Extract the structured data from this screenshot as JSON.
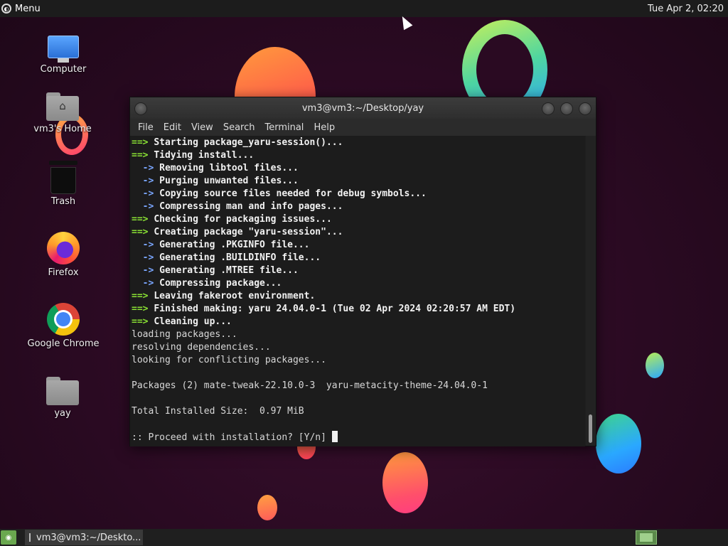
{
  "top_panel": {
    "menu_label": "Menu",
    "clock": "Tue Apr  2, 02:20"
  },
  "desktop": {
    "icons": [
      {
        "label": "Computer",
        "icon": "computer-icon"
      },
      {
        "label": "vm3's Home",
        "icon": "home-folder-icon"
      },
      {
        "label": "Trash",
        "icon": "trash-icon"
      },
      {
        "label": "Firefox",
        "icon": "firefox-icon"
      },
      {
        "label": "Google Chrome",
        "icon": "chrome-icon"
      },
      {
        "label": "yay",
        "icon": "folder-icon"
      }
    ]
  },
  "window": {
    "title": "vm3@vm3:~/Desktop/yay",
    "menu": [
      "File",
      "Edit",
      "View",
      "Search",
      "Terminal",
      "Help"
    ],
    "lines": [
      {
        "prefix": "==> ",
        "kind": "g",
        "text": "Starting package_yaru-session()..."
      },
      {
        "prefix": "==> ",
        "kind": "g",
        "text": "Tidying install..."
      },
      {
        "prefix": "  -> ",
        "kind": "bl",
        "text": "Removing libtool files..."
      },
      {
        "prefix": "  -> ",
        "kind": "bl",
        "text": "Purging unwanted files..."
      },
      {
        "prefix": "  -> ",
        "kind": "bl",
        "text": "Copying source files needed for debug symbols..."
      },
      {
        "prefix": "  -> ",
        "kind": "bl",
        "text": "Compressing man and info pages..."
      },
      {
        "prefix": "==> ",
        "kind": "g",
        "text": "Checking for packaging issues..."
      },
      {
        "prefix": "==> ",
        "kind": "g",
        "text": "Creating package \"yaru-session\"..."
      },
      {
        "prefix": "  -> ",
        "kind": "bl",
        "text": "Generating .PKGINFO file..."
      },
      {
        "prefix": "  -> ",
        "kind": "bl",
        "text": "Generating .BUILDINFO file..."
      },
      {
        "prefix": "  -> ",
        "kind": "bl",
        "text": "Generating .MTREE file..."
      },
      {
        "prefix": "  -> ",
        "kind": "bl",
        "text": "Compressing package..."
      },
      {
        "prefix": "==> ",
        "kind": "g",
        "text": "Leaving fakeroot environment."
      },
      {
        "prefix": "==> ",
        "kind": "g",
        "text": "Finished making: yaru 24.04.0-1 (Tue 02 Apr 2024 02:20:57 AM EDT)"
      },
      {
        "prefix": "==> ",
        "kind": "g",
        "text": "Cleaning up..."
      },
      {
        "prefix": "",
        "kind": "plain",
        "text": "loading packages..."
      },
      {
        "prefix": "",
        "kind": "plain",
        "text": "resolving dependencies..."
      },
      {
        "prefix": "",
        "kind": "plain",
        "text": "looking for conflicting packages..."
      },
      {
        "prefix": "",
        "kind": "plain",
        "text": ""
      },
      {
        "prefix": "",
        "kind": "plain",
        "text": "Packages (2) mate-tweak-22.10.0-3  yaru-metacity-theme-24.04.0-1"
      },
      {
        "prefix": "",
        "kind": "plain",
        "text": ""
      },
      {
        "prefix": "",
        "kind": "plain",
        "text": "Total Installed Size:  0.97 MiB"
      },
      {
        "prefix": "",
        "kind": "plain",
        "text": ""
      }
    ],
    "prompt": ":: Proceed with installation? [Y/n] "
  },
  "bottom_panel": {
    "task_label": "vm3@vm3:~/Deskto..."
  }
}
